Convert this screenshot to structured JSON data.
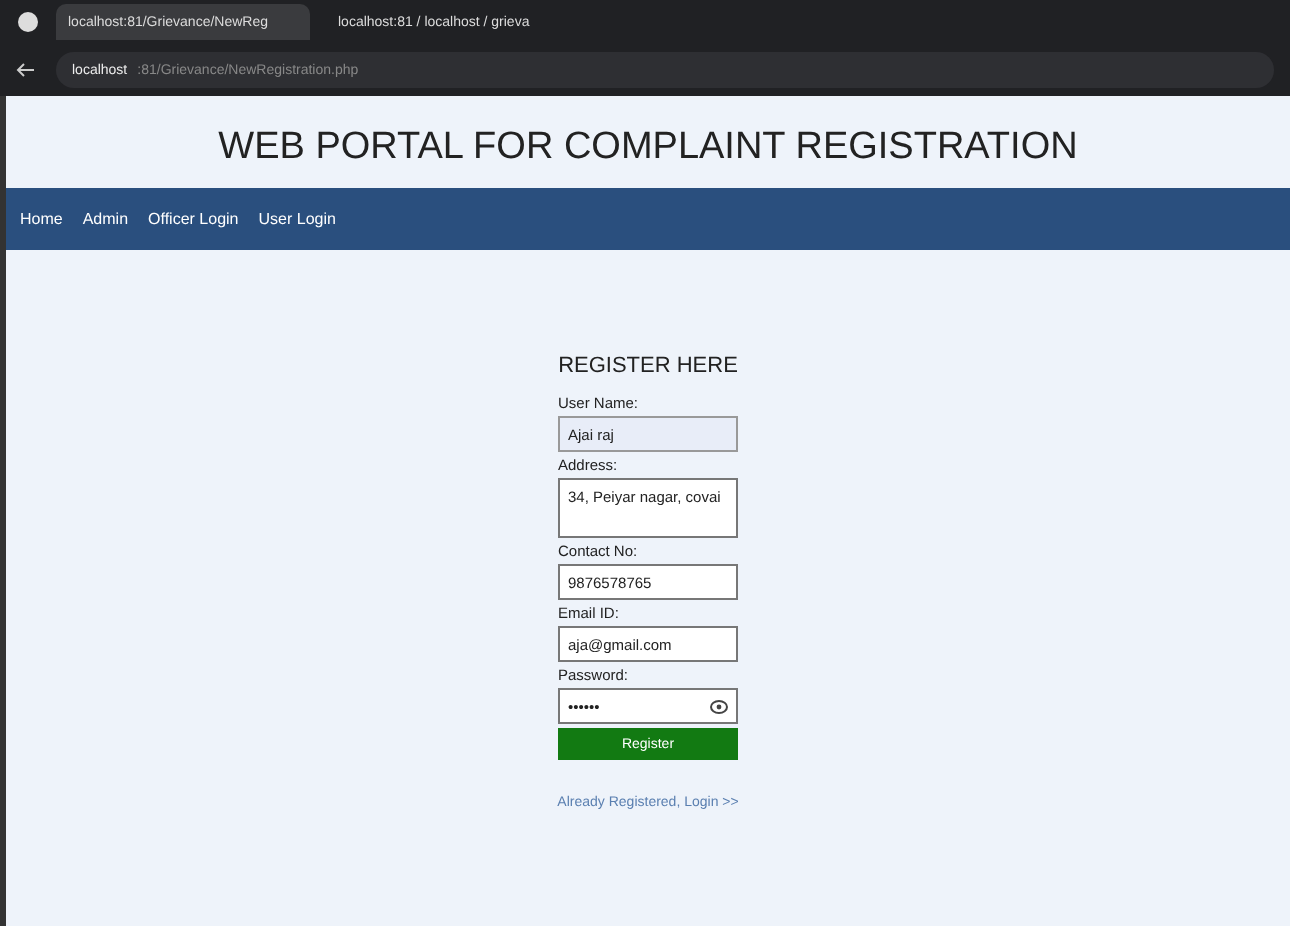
{
  "browser": {
    "tabs": [
      {
        "title": "localhost:81/Grievance/NewReg",
        "selected": true
      },
      {
        "title": "localhost:81 / localhost / grieva",
        "selected": false
      }
    ],
    "address": {
      "host": "localhost",
      "path": ":81/Grievance/NewRegistration.php"
    }
  },
  "header": {
    "title": "WEB PORTAL FOR COMPLAINT REGISTRATION"
  },
  "nav": [
    "Home",
    "Admin",
    "Officer Login",
    "User Login"
  ],
  "form": {
    "title": "REGISTER HERE",
    "fields": [
      {
        "label": "User Name:",
        "value": "Ajai raj",
        "kind": "text",
        "autofilled": true
      },
      {
        "label": "Address:",
        "value": "34, Peiyar nagar, covai",
        "kind": "textarea",
        "autofilled": false
      },
      {
        "label": "Contact No:",
        "value": "9876578765",
        "kind": "text",
        "autofilled": false
      },
      {
        "label": "Email ID:",
        "value": "aja@gmail.com",
        "kind": "text",
        "autofilled": false
      },
      {
        "label": "Password:",
        "value": "••••••",
        "kind": "password",
        "autofilled": false
      }
    ],
    "submit": "Register",
    "link": "Already Registered, Login >>"
  }
}
